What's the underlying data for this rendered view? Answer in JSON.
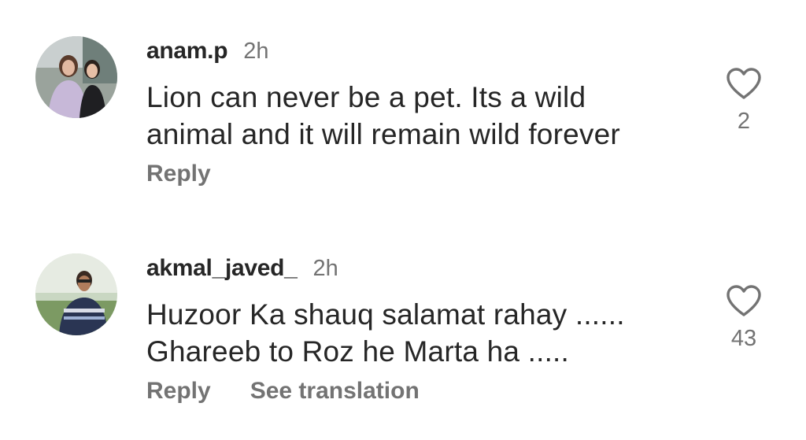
{
  "comments": [
    {
      "username": "anam.p",
      "time": "2h",
      "lines": [
        "Lion can never be a pet. Its a wild",
        "animal and it will remain wild forever"
      ],
      "likes": "2",
      "reply_label": "Reply",
      "avatar_icon": "avatar-photo"
    },
    {
      "username": "akmal_javed_",
      "time": "2h",
      "lines": [
        "Huzoor Ka shauq salamat rahay ......",
        "Ghareeb to Roz he Marta ha ....."
      ],
      "likes": "43",
      "reply_label": "Reply",
      "translation_label": "See translation",
      "avatar_icon": "avatar-photo"
    }
  ],
  "colors": {
    "primary_text": "#262626",
    "secondary_text": "#737373",
    "background": "#ffffff"
  },
  "icons": {
    "like": "heart-outline-icon"
  }
}
